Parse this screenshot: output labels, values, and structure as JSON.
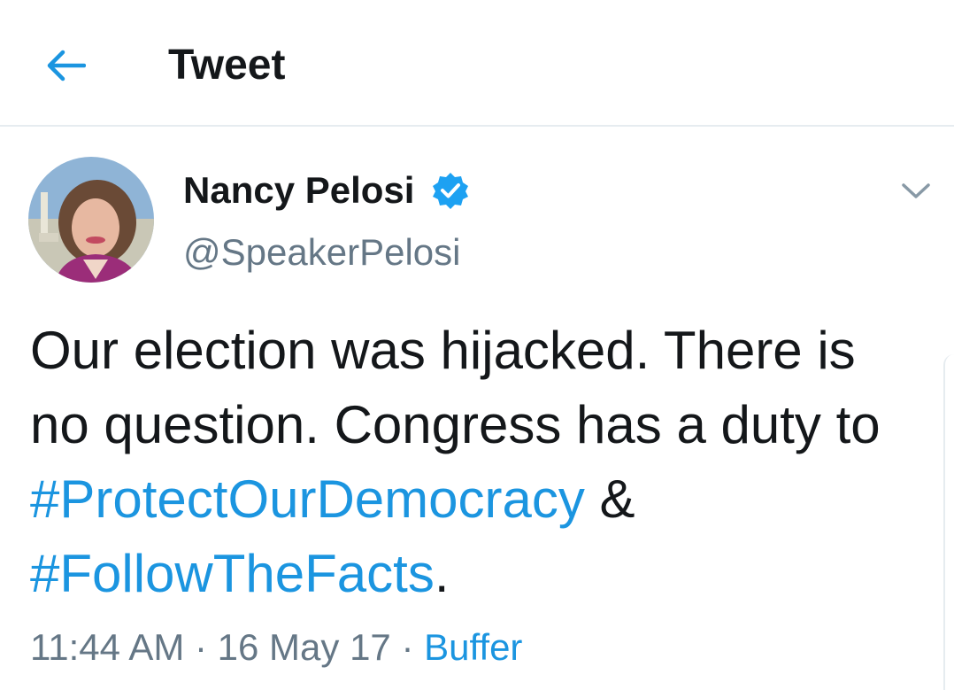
{
  "header": {
    "title": "Tweet",
    "back_icon": "arrow-left-icon"
  },
  "tweet": {
    "author": {
      "name": "Nancy Pelosi",
      "handle": "@SpeakerPelosi",
      "verified": true,
      "verified_icon": "verified-badge-icon"
    },
    "menu_icon": "chevron-down-icon",
    "text_parts": {
      "t1": "Our election was hijacked. There is no question. Congress has a duty to ",
      "hashtag1": "#ProtectOurDemocracy",
      "t2": " & ",
      "hashtag2": "#FollowTheFacts",
      "t3": "."
    },
    "time": "11:44 AM",
    "sep1": " · ",
    "date": "16 May 17",
    "sep2": " · ",
    "source": "Buffer"
  },
  "colors": {
    "link": "#1b95e0",
    "text": "#14171a",
    "secondary": "#657786",
    "divider": "#e6ecf0"
  }
}
